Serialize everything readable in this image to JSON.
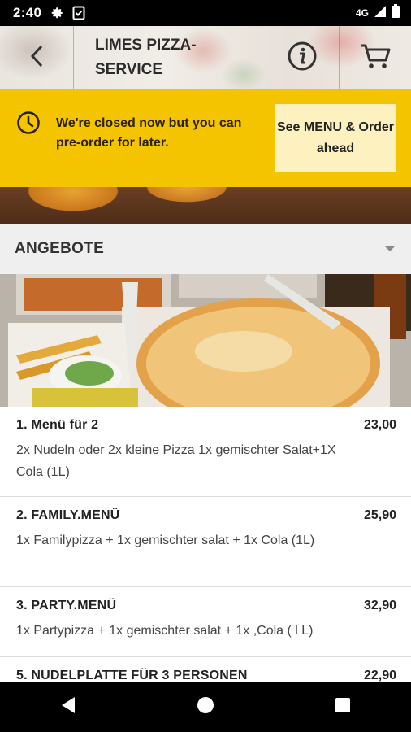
{
  "status_bar": {
    "time": "2:40",
    "network": "4G"
  },
  "header": {
    "title": "LIMES PIZZA-SERVICE",
    "back_icon": "chevron-left-icon",
    "info_icon": "info-icon",
    "cart_icon": "cart-icon"
  },
  "banner": {
    "icon": "clock-icon",
    "message": "We're closed now but you can pre-order for later.",
    "button_label": "See MENU & Order ahead",
    "color": "#f5c400"
  },
  "section": {
    "title": "ANGEBOTE"
  },
  "menu_items": [
    {
      "name": "1. Menü für 2",
      "price": "23,00",
      "description": "2x Nudeln oder 2x kleine Pizza 1x gemischter Salat+1X Cola (1L)"
    },
    {
      "name": "2. FAMILY.MENÜ",
      "price": "25,90",
      "description": "1x Familypizza + 1x gemischter salat + 1x Cola (1L)"
    },
    {
      "name": "3. PARTY.MENÜ",
      "price": "32,90",
      "description": "1x Partypizza + 1x gemischter salat + 1x ,Cola ( l L)"
    },
    {
      "name": "5. NUDELPLATTE FÜR 3 PERSONEN",
      "price": "22,90",
      "description": ""
    }
  ]
}
